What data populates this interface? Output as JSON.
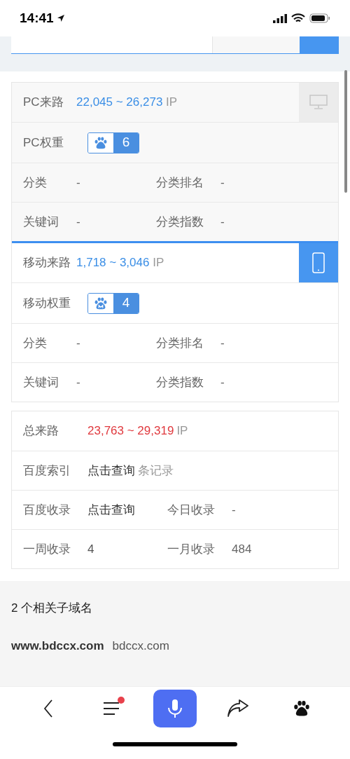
{
  "status_bar": {
    "time": "14:41"
  },
  "sections": [
    {
      "kind": "pc",
      "selected": false,
      "source": {
        "label": "PC来路",
        "value": "22,045 ~ 26,273",
        "unit": "IP",
        "color": "#3a8ee6"
      },
      "weight": {
        "label": "PC权重",
        "value": "6",
        "mobile": false
      },
      "rows": [
        [
          {
            "label": "分类",
            "value": "-"
          },
          {
            "label": "分类排名",
            "value": "-"
          }
        ],
        [
          {
            "label": "关键词",
            "value": "-"
          },
          {
            "label": "分类指数",
            "value": "-"
          }
        ]
      ]
    },
    {
      "kind": "mobile",
      "selected": true,
      "source": {
        "label": "移动来路",
        "value": "1,718 ~ 3,046",
        "unit": "IP",
        "color": "#3a8ee6"
      },
      "weight": {
        "label": "移动权重",
        "value": "4",
        "mobile": true
      },
      "rows": [
        [
          {
            "label": "分类",
            "value": "-"
          },
          {
            "label": "分类排名",
            "value": "-"
          }
        ],
        [
          {
            "label": "关键词",
            "value": "-"
          },
          {
            "label": "分类指数",
            "value": "-"
          }
        ]
      ]
    }
  ],
  "totals": [
    {
      "label": "总来路",
      "value": "23,763 ~ 29,319",
      "unit": "IP",
      "color": "#e0393e"
    },
    {
      "label": "百度索引",
      "link": "点击查询",
      "unit": "条记录"
    },
    {
      "label": "百度收录",
      "link": "点击查询",
      "label2": "今日收录",
      "value2": "-"
    },
    {
      "label": "一周收录",
      "value": "4",
      "label2": "一月收录",
      "value2": "484"
    }
  ],
  "subdomains": {
    "title": "2 个相关子域名",
    "items": [
      {
        "domain": "www.bdccx.com",
        "root": "bdccx.com"
      }
    ]
  },
  "nav": [
    {
      "kind": "back"
    },
    {
      "kind": "menu",
      "badge": true
    },
    {
      "kind": "mic"
    },
    {
      "kind": "share"
    },
    {
      "kind": "paw"
    }
  ]
}
